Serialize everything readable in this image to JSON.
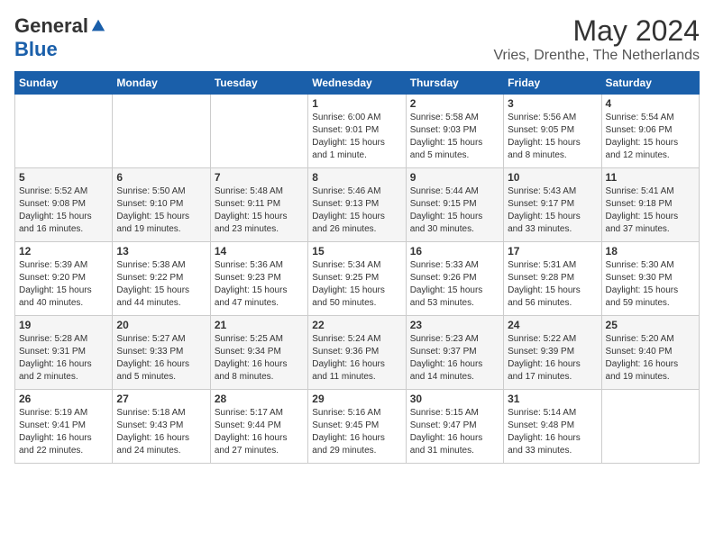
{
  "header": {
    "logo": {
      "general": "General",
      "blue": "Blue"
    },
    "title": "May 2024",
    "location": "Vries, Drenthe, The Netherlands"
  },
  "weekdays": [
    "Sunday",
    "Monday",
    "Tuesday",
    "Wednesday",
    "Thursday",
    "Friday",
    "Saturday"
  ],
  "weeks": [
    [
      {
        "day": "",
        "detail": ""
      },
      {
        "day": "",
        "detail": ""
      },
      {
        "day": "",
        "detail": ""
      },
      {
        "day": "1",
        "detail": "Sunrise: 6:00 AM\nSunset: 9:01 PM\nDaylight: 15 hours\nand 1 minute."
      },
      {
        "day": "2",
        "detail": "Sunrise: 5:58 AM\nSunset: 9:03 PM\nDaylight: 15 hours\nand 5 minutes."
      },
      {
        "day": "3",
        "detail": "Sunrise: 5:56 AM\nSunset: 9:05 PM\nDaylight: 15 hours\nand 8 minutes."
      },
      {
        "day": "4",
        "detail": "Sunrise: 5:54 AM\nSunset: 9:06 PM\nDaylight: 15 hours\nand 12 minutes."
      }
    ],
    [
      {
        "day": "5",
        "detail": "Sunrise: 5:52 AM\nSunset: 9:08 PM\nDaylight: 15 hours\nand 16 minutes."
      },
      {
        "day": "6",
        "detail": "Sunrise: 5:50 AM\nSunset: 9:10 PM\nDaylight: 15 hours\nand 19 minutes."
      },
      {
        "day": "7",
        "detail": "Sunrise: 5:48 AM\nSunset: 9:11 PM\nDaylight: 15 hours\nand 23 minutes."
      },
      {
        "day": "8",
        "detail": "Sunrise: 5:46 AM\nSunset: 9:13 PM\nDaylight: 15 hours\nand 26 minutes."
      },
      {
        "day": "9",
        "detail": "Sunrise: 5:44 AM\nSunset: 9:15 PM\nDaylight: 15 hours\nand 30 minutes."
      },
      {
        "day": "10",
        "detail": "Sunrise: 5:43 AM\nSunset: 9:17 PM\nDaylight: 15 hours\nand 33 minutes."
      },
      {
        "day": "11",
        "detail": "Sunrise: 5:41 AM\nSunset: 9:18 PM\nDaylight: 15 hours\nand 37 minutes."
      }
    ],
    [
      {
        "day": "12",
        "detail": "Sunrise: 5:39 AM\nSunset: 9:20 PM\nDaylight: 15 hours\nand 40 minutes."
      },
      {
        "day": "13",
        "detail": "Sunrise: 5:38 AM\nSunset: 9:22 PM\nDaylight: 15 hours\nand 44 minutes."
      },
      {
        "day": "14",
        "detail": "Sunrise: 5:36 AM\nSunset: 9:23 PM\nDaylight: 15 hours\nand 47 minutes."
      },
      {
        "day": "15",
        "detail": "Sunrise: 5:34 AM\nSunset: 9:25 PM\nDaylight: 15 hours\nand 50 minutes."
      },
      {
        "day": "16",
        "detail": "Sunrise: 5:33 AM\nSunset: 9:26 PM\nDaylight: 15 hours\nand 53 minutes."
      },
      {
        "day": "17",
        "detail": "Sunrise: 5:31 AM\nSunset: 9:28 PM\nDaylight: 15 hours\nand 56 minutes."
      },
      {
        "day": "18",
        "detail": "Sunrise: 5:30 AM\nSunset: 9:30 PM\nDaylight: 15 hours\nand 59 minutes."
      }
    ],
    [
      {
        "day": "19",
        "detail": "Sunrise: 5:28 AM\nSunset: 9:31 PM\nDaylight: 16 hours\nand 2 minutes."
      },
      {
        "day": "20",
        "detail": "Sunrise: 5:27 AM\nSunset: 9:33 PM\nDaylight: 16 hours\nand 5 minutes."
      },
      {
        "day": "21",
        "detail": "Sunrise: 5:25 AM\nSunset: 9:34 PM\nDaylight: 16 hours\nand 8 minutes."
      },
      {
        "day": "22",
        "detail": "Sunrise: 5:24 AM\nSunset: 9:36 PM\nDaylight: 16 hours\nand 11 minutes."
      },
      {
        "day": "23",
        "detail": "Sunrise: 5:23 AM\nSunset: 9:37 PM\nDaylight: 16 hours\nand 14 minutes."
      },
      {
        "day": "24",
        "detail": "Sunrise: 5:22 AM\nSunset: 9:39 PM\nDaylight: 16 hours\nand 17 minutes."
      },
      {
        "day": "25",
        "detail": "Sunrise: 5:20 AM\nSunset: 9:40 PM\nDaylight: 16 hours\nand 19 minutes."
      }
    ],
    [
      {
        "day": "26",
        "detail": "Sunrise: 5:19 AM\nSunset: 9:41 PM\nDaylight: 16 hours\nand 22 minutes."
      },
      {
        "day": "27",
        "detail": "Sunrise: 5:18 AM\nSunset: 9:43 PM\nDaylight: 16 hours\nand 24 minutes."
      },
      {
        "day": "28",
        "detail": "Sunrise: 5:17 AM\nSunset: 9:44 PM\nDaylight: 16 hours\nand 27 minutes."
      },
      {
        "day": "29",
        "detail": "Sunrise: 5:16 AM\nSunset: 9:45 PM\nDaylight: 16 hours\nand 29 minutes."
      },
      {
        "day": "30",
        "detail": "Sunrise: 5:15 AM\nSunset: 9:47 PM\nDaylight: 16 hours\nand 31 minutes."
      },
      {
        "day": "31",
        "detail": "Sunrise: 5:14 AM\nSunset: 9:48 PM\nDaylight: 16 hours\nand 33 minutes."
      },
      {
        "day": "",
        "detail": ""
      }
    ]
  ]
}
